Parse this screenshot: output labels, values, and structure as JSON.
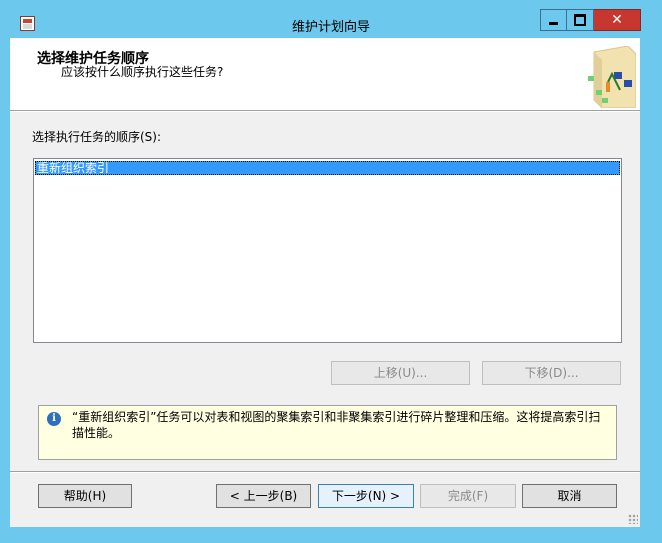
{
  "window": {
    "title": "维护计划向导",
    "close_glyph": "✕"
  },
  "header": {
    "title": "选择维护任务顺序",
    "subtitle": "应该按什么顺序执行这些任务?"
  },
  "task_list": {
    "label": "选择执行任务的顺序(S):",
    "items": [
      "重新组织索引"
    ],
    "selected_index": 0
  },
  "move_buttons": {
    "up_label": "上移(U)...",
    "down_label": "下移(D)..."
  },
  "info": {
    "icon_glyph": "i",
    "text": "“重新组织索引”任务可以对表和视图的聚集索引和非聚集索引进行碎片整理和压缩。这将提高索引扫描性能。"
  },
  "footer": {
    "help_label": "帮助(H)",
    "back_label": "< 上一步(B)",
    "next_label": "下一步(N) >",
    "finish_label": "完成(F)",
    "cancel_label": "取消"
  },
  "colors": {
    "titlebar": "#6cc8ec",
    "close_button": "#c7372f",
    "selection": "#3399ff",
    "info_background": "#ffffe1"
  }
}
